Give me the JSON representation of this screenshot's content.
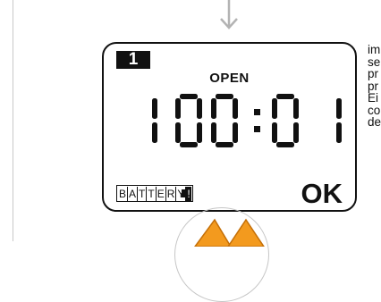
{
  "display": {
    "badge": "1",
    "status": "OPEN",
    "time_digits": [
      "1",
      "0",
      "0",
      "0",
      "1"
    ],
    "battery_letters": [
      "B",
      "A",
      "T",
      "T",
      "E",
      "R",
      "Y",
      "!"
    ],
    "result": "OK"
  },
  "side_text": [
    "im",
    "se",
    "pr",
    "pr",
    "Ei",
    "co",
    "de"
  ],
  "icons": {
    "arrow": "down-arrow-icon",
    "buttons": "orange-arrow-buttons-icon"
  },
  "colors": {
    "lcd_ink": "#111111",
    "orange": "#f39a1e",
    "arrow_grey": "#b3b3b3"
  }
}
